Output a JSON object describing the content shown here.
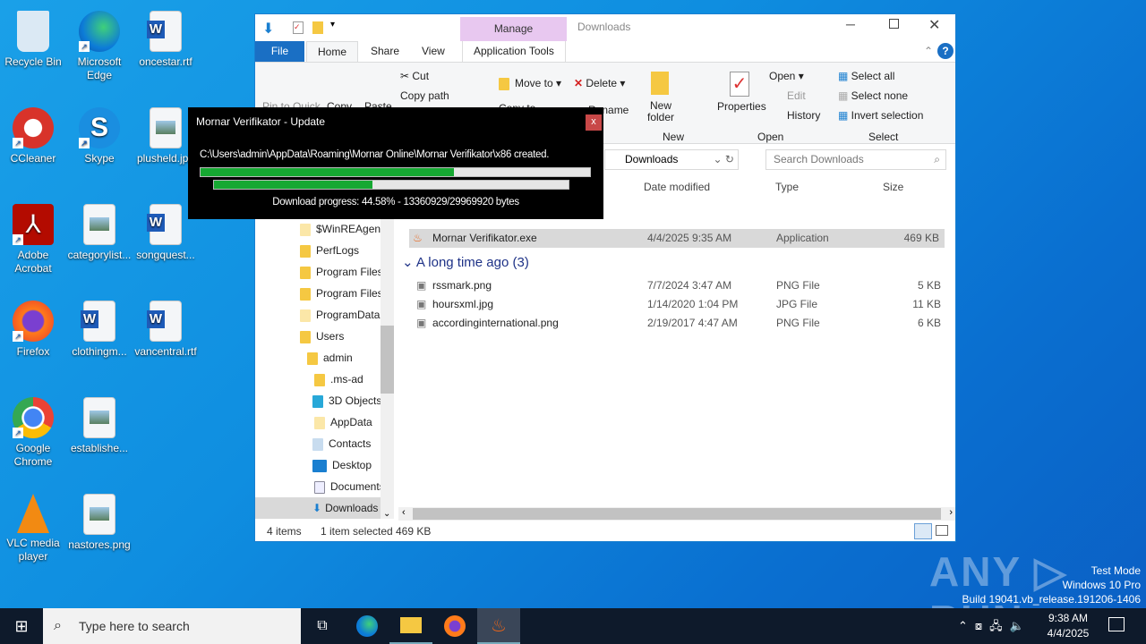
{
  "desktop": {
    "icons": [
      {
        "label": "Recycle Bin",
        "icon": "recycle-bin-icon"
      },
      {
        "label": "Microsoft Edge",
        "icon": "edge-icon"
      },
      {
        "label": "oncestar.rtf",
        "icon": "word-doc-icon"
      },
      {
        "label": "CCleaner",
        "icon": "ccleaner-icon"
      },
      {
        "label": "Skype",
        "icon": "skype-icon"
      },
      {
        "label": "plusheld.jpg",
        "icon": "image-file-icon"
      },
      {
        "label": "Adobe Acrobat",
        "icon": "acrobat-icon"
      },
      {
        "label": "categorylist...",
        "icon": "image-file-icon"
      },
      {
        "label": "songquest...",
        "icon": "word-doc-icon"
      },
      {
        "label": "Firefox",
        "icon": "firefox-icon"
      },
      {
        "label": "clothingm...",
        "icon": "word-doc-icon"
      },
      {
        "label": "vancentral.rtf",
        "icon": "word-doc-icon"
      },
      {
        "label": "Google Chrome",
        "icon": "chrome-icon"
      },
      {
        "label": "establishe...",
        "icon": "image-file-icon"
      },
      {
        "label": "VLC media player",
        "icon": "vlc-icon"
      },
      {
        "label": "nastores.png",
        "icon": "image-file-icon"
      }
    ]
  },
  "explorer": {
    "title": "Downloads",
    "context_tab": "Manage",
    "tabs": [
      "File",
      "Home",
      "Share",
      "View",
      "Application Tools"
    ],
    "ribbon": {
      "pin": "Pin to Quick",
      "copy": "Copy",
      "paste": "Paste",
      "cut": "Cut",
      "copy_path": "Copy path",
      "move_to": "Move to",
      "copy_to": "Copy to",
      "delete": "Delete",
      "rename": "Rename",
      "new_folder": "New folder",
      "properties": "Properties",
      "open": "Open",
      "edit": "Edit",
      "history": "History",
      "select_all": "Select all",
      "select_none": "Select none",
      "invert_selection": "Invert selection",
      "groups": {
        "new": "New",
        "open": "Open",
        "select": "Select"
      }
    },
    "address": "Downloads",
    "search_placeholder": "Search Downloads",
    "columns": [
      "Date modified",
      "Type",
      "Size"
    ],
    "nav": [
      "$WinREAgent",
      "PerfLogs",
      "Program Files",
      "Program Files",
      "ProgramData",
      "Users",
      "admin",
      ".ms-ad",
      "3D Objects",
      "AppData",
      "Contacts",
      "Desktop",
      "Documents",
      "Downloads"
    ],
    "selected_file": {
      "name": "Mornar Verifikator.exe",
      "date": "4/4/2025 9:35 AM",
      "type": "Application",
      "size": "469 KB"
    },
    "group_label": "A long time ago (3)",
    "files": [
      {
        "name": "rssmark.png",
        "date": "7/7/2024 3:47 AM",
        "type": "PNG File",
        "size": "5 KB"
      },
      {
        "name": "hoursxml.jpg",
        "date": "1/14/2020 1:04 PM",
        "type": "JPG File",
        "size": "11 KB"
      },
      {
        "name": "accordinginternational.png",
        "date": "2/19/2017 4:47 AM",
        "type": "PNG File",
        "size": "6 KB"
      }
    ],
    "status": {
      "count": "4 items",
      "selected": "1 item selected",
      "size": "469 KB"
    }
  },
  "dialog": {
    "title": "Mornar Verifikator - Update",
    "close": "x",
    "message": "C:\\Users\\admin\\AppData\\Roaming\\Mornar Online\\Mornar Verifikator\\x86 created.",
    "progress_overall": 0.65,
    "progress_download": 0.4458,
    "progress_text": "Download progress: 44.58% - 13360929/29969920 bytes"
  },
  "taskbar": {
    "search_placeholder": "Type here to search",
    "time": "9:38 AM",
    "date": "4/4/2025"
  },
  "watermark": {
    "brand": "ANY RUN",
    "line1": "Test Mode",
    "line2": "Windows 10 Pro",
    "line3": "Build 19041.vb_release.191206-1406"
  }
}
